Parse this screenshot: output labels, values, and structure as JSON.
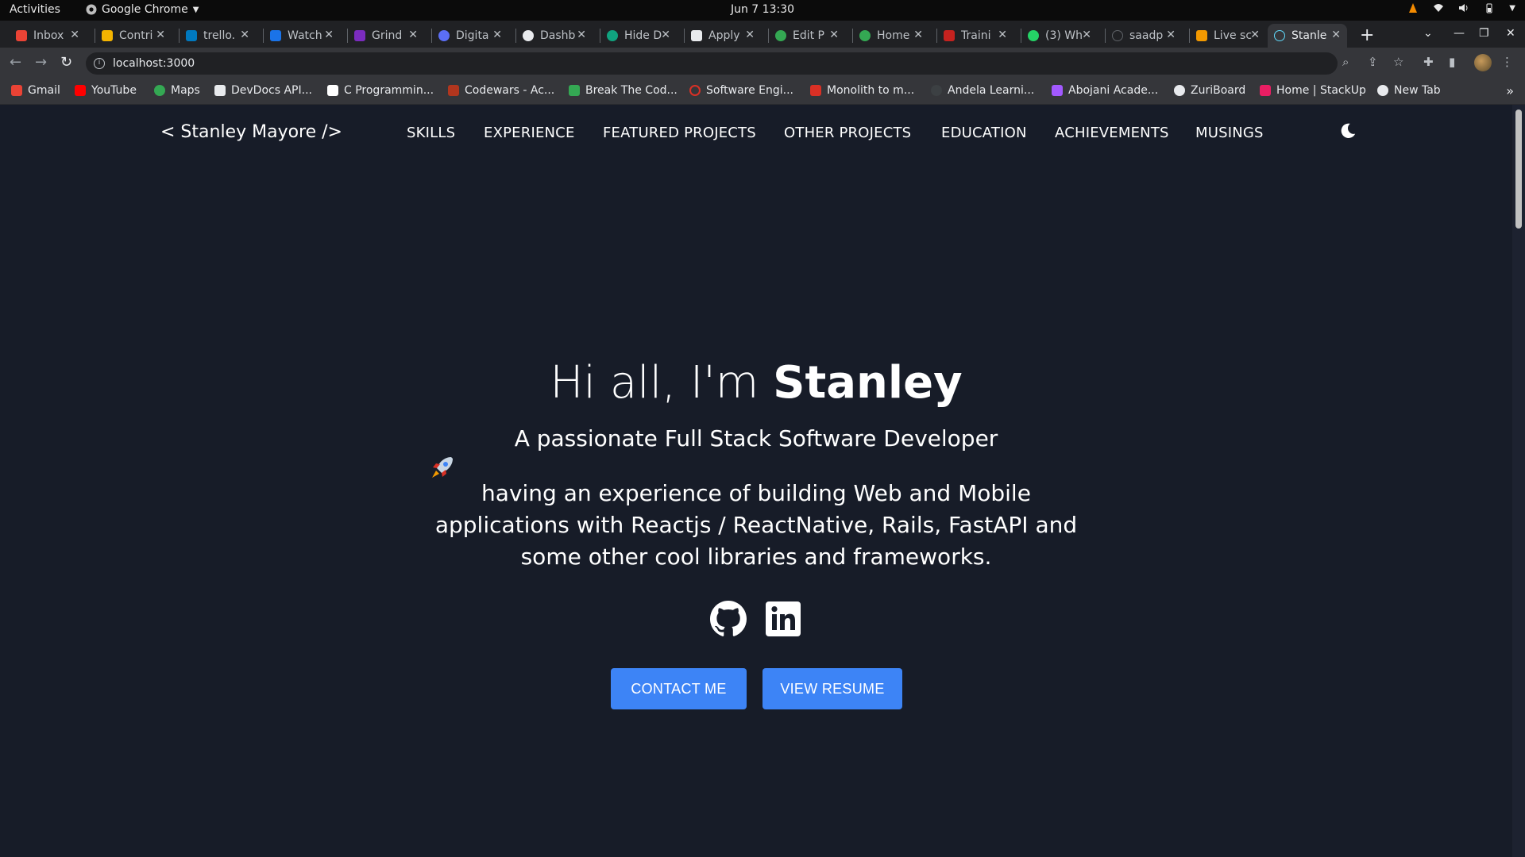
{
  "system_bar": {
    "activities": "Activities",
    "app_name": "Google Chrome",
    "clock": "Jun 7  13:30"
  },
  "tabs": [
    {
      "label": "Inbox",
      "icon": "gmail-icon",
      "color": "#ea4335"
    },
    {
      "label": "Contri",
      "icon": "contrib-icon",
      "color": "#f4b400"
    },
    {
      "label": "trello.",
      "icon": "trello-icon",
      "color": "#0079bf"
    },
    {
      "label": "Watch",
      "icon": "watch-icon",
      "color": "#1a73e8"
    },
    {
      "label": "Grind",
      "icon": "grind-icon",
      "color": "#7b2cbf"
    },
    {
      "label": "Digita",
      "icon": "digital-icon",
      "color": "#5b6ef5"
    },
    {
      "label": "Dashb",
      "icon": "dashboard-icon",
      "color": "#e8eaed"
    },
    {
      "label": "Hide D",
      "icon": "chatgpt-icon",
      "color": "#10a37f"
    },
    {
      "label": "Apply",
      "icon": "apply-icon",
      "color": "#e8eaed"
    },
    {
      "label": "Edit P",
      "icon": "edit-icon",
      "color": "#34a853"
    },
    {
      "label": "Home",
      "icon": "home-icon",
      "color": "#34a853"
    },
    {
      "label": "Traini",
      "icon": "training-icon",
      "color": "#c5221f"
    },
    {
      "label": "(3) Wh",
      "icon": "whatsapp-icon",
      "color": "#25d366"
    },
    {
      "label": "saadp",
      "icon": "github-tab-icon",
      "color": "#202124"
    },
    {
      "label": "Live sc",
      "icon": "livescore-icon",
      "color": "#f29900"
    },
    {
      "label": "Stanle",
      "icon": "react-icon",
      "color": "#61dafb",
      "active": true
    }
  ],
  "address_bar": {
    "url": "localhost:3000"
  },
  "bookmarks": [
    {
      "label": "Gmail",
      "icon": "gmail-icon",
      "color": "#ea4335"
    },
    {
      "label": "YouTube",
      "icon": "youtube-icon",
      "color": "#ff0000"
    },
    {
      "label": "Maps",
      "icon": "maps-icon",
      "color": "#34a853"
    },
    {
      "label": "DevDocs API...",
      "icon": "devdocs-icon",
      "color": "#e8eaed"
    },
    {
      "label": "C Programmin...",
      "icon": "cprog-icon",
      "color": "#ffffff"
    },
    {
      "label": "Codewars - Ac...",
      "icon": "codewars-icon",
      "color": "#b1361e"
    },
    {
      "label": "Break The Cod...",
      "icon": "breakcode-icon",
      "color": "#34a853"
    },
    {
      "label": "Software Engi...",
      "icon": "software-icon",
      "color": "#d93025"
    },
    {
      "label": "Monolith to m...",
      "icon": "monolith-icon",
      "color": "#d93025"
    },
    {
      "label": "Andela Learni...",
      "icon": "andela-icon",
      "color": "#3c4043"
    },
    {
      "label": "Abojani Acade...",
      "icon": "figma-icon",
      "color": "#a259ff"
    },
    {
      "label": "ZuriBoard",
      "icon": "zuri-icon",
      "color": "#e8eaed"
    },
    {
      "label": "Home | StackUp",
      "icon": "stackup-icon",
      "color": "#e91e63"
    },
    {
      "label": "New Tab",
      "icon": "chrome-icon",
      "color": "#e8eaed"
    }
  ],
  "site": {
    "logo": "< Stanley Mayore />",
    "nav": [
      "SKILLS",
      "EXPERIENCE",
      "FEATURED PROJECTS",
      "OTHER PROJECTS",
      "EDUCATION",
      "ACHIEVEMENTS",
      "MUSINGS"
    ],
    "greeting_prefix": "Hi all, I'm ",
    "greeting_name": "Stanley",
    "subtitle": "A passionate Full Stack Software Developer",
    "description": "having an experience of building Web and Mobile applications with Reactjs / ReactNative, Rails, FastAPI and some other cool libraries and frameworks.",
    "contact_button": "CONTACT ME",
    "resume_button": "VIEW RESUME",
    "accent_color": "#3d84f6",
    "background_color": "#171c28"
  }
}
